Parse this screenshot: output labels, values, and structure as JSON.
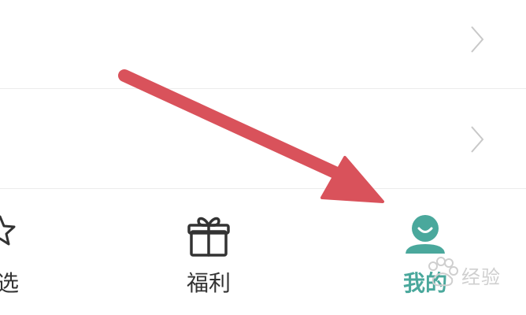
{
  "list": {
    "rows": [
      {
        "chevron_icon": "chevron-right-icon"
      },
      {
        "chevron_icon": "chevron-right-icon"
      }
    ]
  },
  "tab_bar": {
    "tabs": [
      {
        "label": "选",
        "icon": "star-icon",
        "active": false
      },
      {
        "label": "福利",
        "icon": "gift-icon",
        "active": false
      },
      {
        "label": "我的",
        "icon": "user-profile-icon",
        "active": true
      }
    ],
    "active_color": "#4aa89c",
    "inactive_color": "#333333"
  },
  "annotation": {
    "arrow_color": "#d9525b",
    "icon": "pointer-arrow"
  },
  "watermark": {
    "text": "经验",
    "icon": "baidu-paw-logo"
  }
}
